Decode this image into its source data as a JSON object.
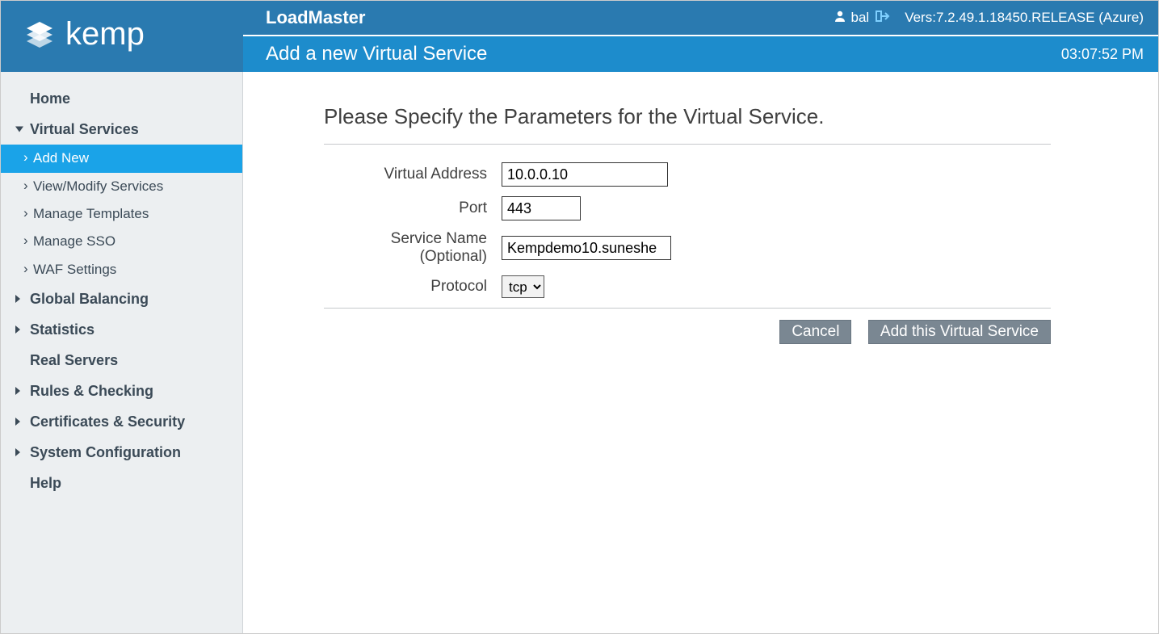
{
  "header": {
    "app_title": "LoadMaster",
    "username": "bal",
    "version": "Vers:7.2.49.1.18450.RELEASE (Azure)",
    "page_title": "Add a new Virtual Service",
    "clock": "03:07:52 PM"
  },
  "sidebar": {
    "home": "Home",
    "virtual_services": {
      "label": "Virtual Services",
      "items": [
        "Add New",
        "View/Modify Services",
        "Manage Templates",
        "Manage SSO",
        "WAF Settings"
      ]
    },
    "global_balancing": "Global Balancing",
    "statistics": "Statistics",
    "real_servers": "Real Servers",
    "rules_checking": "Rules & Checking",
    "certs_security": "Certificates & Security",
    "system_config": "System Configuration",
    "help": "Help"
  },
  "form": {
    "heading": "Please Specify the Parameters for the Virtual Service.",
    "labels": {
      "virtual_address": "Virtual Address",
      "port": "Port",
      "service_name": "Service Name (Optional)",
      "protocol": "Protocol"
    },
    "values": {
      "virtual_address": "10.0.0.10",
      "port": "443",
      "service_name": "Kempdemo10.suneshe",
      "protocol": "tcp"
    },
    "buttons": {
      "cancel": "Cancel",
      "submit": "Add this Virtual Service"
    }
  }
}
